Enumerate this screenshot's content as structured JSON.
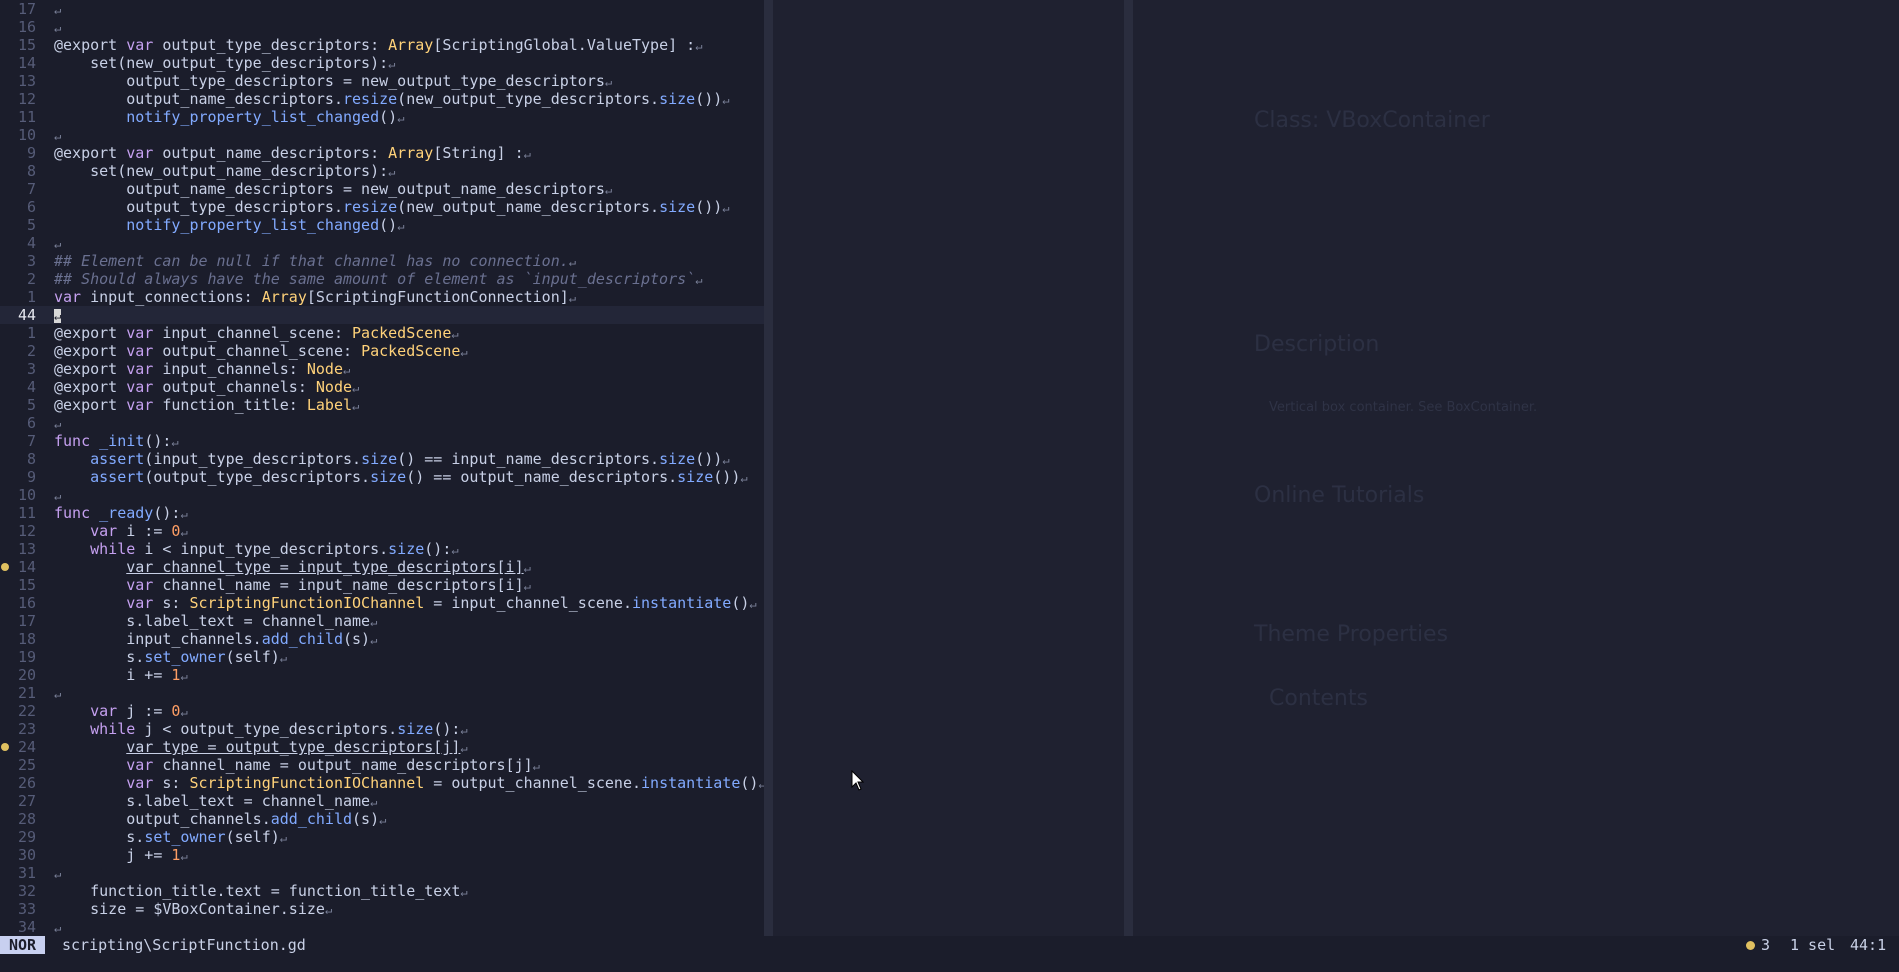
{
  "editor": {
    "current_line": "44",
    "lines": [
      {
        "n": "17",
        "tokens": []
      },
      {
        "n": "16",
        "tokens": []
      },
      {
        "n": "15",
        "tokens": [
          [
            "dec",
            "@export "
          ],
          [
            "kw",
            "var "
          ],
          [
            "plain",
            "output_type_descriptors: "
          ],
          [
            "type",
            "Array"
          ],
          [
            "plain",
            "[ScriptingGlobal.ValueType] :"
          ]
        ]
      },
      {
        "n": "14",
        "tokens": [
          [
            "plain",
            "    set(new_output_type_descriptors):"
          ]
        ]
      },
      {
        "n": "13",
        "tokens": [
          [
            "plain",
            "        output_type_descriptors = new_output_type_descriptors"
          ]
        ]
      },
      {
        "n": "12",
        "tokens": [
          [
            "plain",
            "        output_name_descriptors."
          ],
          [
            "fn",
            "resize"
          ],
          [
            "plain",
            "(new_output_type_descriptors."
          ],
          [
            "fn",
            "size"
          ],
          [
            "plain",
            "())"
          ]
        ]
      },
      {
        "n": "11",
        "tokens": [
          [
            "plain",
            "        "
          ],
          [
            "fn",
            "notify_property_list_changed"
          ],
          [
            "plain",
            "()"
          ]
        ]
      },
      {
        "n": "10",
        "tokens": []
      },
      {
        "n": "9",
        "tokens": [
          [
            "dec",
            "@export "
          ],
          [
            "kw",
            "var "
          ],
          [
            "plain",
            "output_name_descriptors: "
          ],
          [
            "type",
            "Array"
          ],
          [
            "plain",
            "[String] :"
          ]
        ]
      },
      {
        "n": "8",
        "tokens": [
          [
            "plain",
            "    set(new_output_name_descriptors):"
          ]
        ]
      },
      {
        "n": "7",
        "tokens": [
          [
            "plain",
            "        output_name_descriptors = new_output_name_descriptors"
          ]
        ]
      },
      {
        "n": "6",
        "tokens": [
          [
            "plain",
            "        output_type_descriptors."
          ],
          [
            "fn",
            "resize"
          ],
          [
            "plain",
            "(new_output_name_descriptors."
          ],
          [
            "fn",
            "size"
          ],
          [
            "plain",
            "())"
          ]
        ]
      },
      {
        "n": "5",
        "tokens": [
          [
            "plain",
            "        "
          ],
          [
            "fn",
            "notify_property_list_changed"
          ],
          [
            "plain",
            "()"
          ]
        ]
      },
      {
        "n": "4",
        "tokens": []
      },
      {
        "n": "3",
        "tokens": [
          [
            "cmt",
            "## Element can be null if that channel has no connection."
          ]
        ]
      },
      {
        "n": "2",
        "tokens": [
          [
            "cmt",
            "## Should always have the same amount of element as `input_descriptors`"
          ]
        ]
      },
      {
        "n": "1",
        "tokens": [
          [
            "kw",
            "var "
          ],
          [
            "plain",
            "input_connections: "
          ],
          [
            "type",
            "Array"
          ],
          [
            "plain",
            "[ScriptingFunctionConnection]"
          ]
        ]
      },
      {
        "n": "44",
        "current": true,
        "tokens": []
      },
      {
        "n": "1",
        "tokens": [
          [
            "dec",
            "@export "
          ],
          [
            "kw",
            "var "
          ],
          [
            "plain",
            "input_channel_scene: "
          ],
          [
            "type",
            "PackedScene"
          ]
        ]
      },
      {
        "n": "2",
        "tokens": [
          [
            "dec",
            "@export "
          ],
          [
            "kw",
            "var "
          ],
          [
            "plain",
            "output_channel_scene: "
          ],
          [
            "type",
            "PackedScene"
          ]
        ]
      },
      {
        "n": "3",
        "tokens": [
          [
            "dec",
            "@export "
          ],
          [
            "kw",
            "var "
          ],
          [
            "plain",
            "input_channels: "
          ],
          [
            "type",
            "Node"
          ]
        ]
      },
      {
        "n": "4",
        "tokens": [
          [
            "dec",
            "@export "
          ],
          [
            "kw",
            "var "
          ],
          [
            "plain",
            "output_channels: "
          ],
          [
            "type",
            "Node"
          ]
        ]
      },
      {
        "n": "5",
        "tokens": [
          [
            "dec",
            "@export "
          ],
          [
            "kw",
            "var "
          ],
          [
            "plain",
            "function_title: "
          ],
          [
            "type",
            "Label"
          ]
        ]
      },
      {
        "n": "6",
        "tokens": []
      },
      {
        "n": "7",
        "tokens": [
          [
            "kw",
            "func "
          ],
          [
            "fn",
            "_init"
          ],
          [
            "plain",
            "():"
          ]
        ]
      },
      {
        "n": "8",
        "tokens": [
          [
            "plain",
            "    "
          ],
          [
            "fn",
            "assert"
          ],
          [
            "plain",
            "(input_type_descriptors."
          ],
          [
            "fn",
            "size"
          ],
          [
            "plain",
            "() == input_name_descriptors."
          ],
          [
            "fn",
            "size"
          ],
          [
            "plain",
            "())"
          ]
        ]
      },
      {
        "n": "9",
        "tokens": [
          [
            "plain",
            "    "
          ],
          [
            "fn",
            "assert"
          ],
          [
            "plain",
            "(output_type_descriptors."
          ],
          [
            "fn",
            "size"
          ],
          [
            "plain",
            "() == output_name_descriptors."
          ],
          [
            "fn",
            "size"
          ],
          [
            "plain",
            "())"
          ]
        ]
      },
      {
        "n": "10",
        "tokens": []
      },
      {
        "n": "11",
        "tokens": [
          [
            "kw",
            "func "
          ],
          [
            "fn",
            "_ready"
          ],
          [
            "plain",
            "():"
          ]
        ]
      },
      {
        "n": "12",
        "tokens": [
          [
            "plain",
            "    "
          ],
          [
            "kw",
            "var "
          ],
          [
            "plain",
            "i := "
          ],
          [
            "num",
            "0"
          ]
        ]
      },
      {
        "n": "13",
        "tokens": [
          [
            "plain",
            "    "
          ],
          [
            "kw",
            "while "
          ],
          [
            "plain",
            "i < input_type_descriptors."
          ],
          [
            "fn",
            "size"
          ],
          [
            "plain",
            "():"
          ]
        ]
      },
      {
        "n": "14",
        "mark": true,
        "tokens": [
          [
            "plain",
            "        "
          ],
          [
            "ul",
            "var channel_type = input_type_descriptors[i]"
          ]
        ]
      },
      {
        "n": "15",
        "tokens": [
          [
            "plain",
            "        "
          ],
          [
            "kw",
            "var "
          ],
          [
            "plain",
            "channel_name = input_name_descriptors[i]"
          ]
        ]
      },
      {
        "n": "16",
        "tokens": [
          [
            "plain",
            "        "
          ],
          [
            "kw",
            "var "
          ],
          [
            "plain",
            "s: "
          ],
          [
            "type",
            "ScriptingFunctionIOChannel"
          ],
          [
            "plain",
            " = input_channel_scene."
          ],
          [
            "fn",
            "instantiate"
          ],
          [
            "plain",
            "()"
          ]
        ]
      },
      {
        "n": "17",
        "tokens": [
          [
            "plain",
            "        s.label_text = channel_name"
          ]
        ]
      },
      {
        "n": "18",
        "tokens": [
          [
            "plain",
            "        input_channels."
          ],
          [
            "fn",
            "add_child"
          ],
          [
            "plain",
            "(s)"
          ]
        ]
      },
      {
        "n": "19",
        "tokens": [
          [
            "plain",
            "        s."
          ],
          [
            "fn",
            "set_owner"
          ],
          [
            "plain",
            "(self)"
          ]
        ]
      },
      {
        "n": "20",
        "tokens": [
          [
            "plain",
            "        i += "
          ],
          [
            "num",
            "1"
          ]
        ]
      },
      {
        "n": "21",
        "tokens": []
      },
      {
        "n": "22",
        "tokens": [
          [
            "plain",
            "    "
          ],
          [
            "kw",
            "var "
          ],
          [
            "plain",
            "j := "
          ],
          [
            "num",
            "0"
          ]
        ]
      },
      {
        "n": "23",
        "tokens": [
          [
            "plain",
            "    "
          ],
          [
            "kw",
            "while "
          ],
          [
            "plain",
            "j < output_type_descriptors."
          ],
          [
            "fn",
            "size"
          ],
          [
            "plain",
            "():"
          ]
        ]
      },
      {
        "n": "24",
        "mark": true,
        "tokens": [
          [
            "plain",
            "        "
          ],
          [
            "ul",
            "var type = output_type_descriptors[j]"
          ]
        ]
      },
      {
        "n": "25",
        "tokens": [
          [
            "plain",
            "        "
          ],
          [
            "kw",
            "var "
          ],
          [
            "plain",
            "channel_name = output_name_descriptors[j]"
          ]
        ]
      },
      {
        "n": "26",
        "tokens": [
          [
            "plain",
            "        "
          ],
          [
            "kw",
            "var "
          ],
          [
            "plain",
            "s: "
          ],
          [
            "type",
            "ScriptingFunctionIOChannel"
          ],
          [
            "plain",
            " = output_channel_scene."
          ],
          [
            "fn",
            "instantiate"
          ],
          [
            "plain",
            "()"
          ]
        ]
      },
      {
        "n": "27",
        "tokens": [
          [
            "plain",
            "        s.label_text = channel_name"
          ]
        ]
      },
      {
        "n": "28",
        "tokens": [
          [
            "plain",
            "        output_channels."
          ],
          [
            "fn",
            "add_child"
          ],
          [
            "plain",
            "(s)"
          ]
        ]
      },
      {
        "n": "29",
        "tokens": [
          [
            "plain",
            "        s."
          ],
          [
            "fn",
            "set_owner"
          ],
          [
            "plain",
            "(self)"
          ]
        ]
      },
      {
        "n": "30",
        "tokens": [
          [
            "plain",
            "        j += "
          ],
          [
            "num",
            "1"
          ]
        ]
      },
      {
        "n": "31",
        "tokens": []
      },
      {
        "n": "32",
        "tokens": [
          [
            "plain",
            "    function_title.text = function_title_text"
          ]
        ]
      },
      {
        "n": "33",
        "tokens": [
          [
            "plain",
            "    size = $VBoxContainer.size"
          ]
        ]
      },
      {
        "n": "34",
        "tokens": []
      }
    ]
  },
  "background_app": {
    "class_title": "Class: VBoxContainer",
    "description_heading": "Description",
    "description_text": "Vertical box container. See BoxContainer.",
    "tutorials_heading": "Online Tutorials",
    "theme_heading": "Theme Properties",
    "contents_heading": "Contents"
  },
  "statusbar": {
    "mode": "NOR",
    "file": "scripting\\ScriptFunction.gd",
    "diagnostics": "3",
    "selection": "1 sel",
    "position": "44:1"
  },
  "colors": {
    "background": "#1b1d2b",
    "keyword": "#c5a0f0",
    "function": "#82aaff",
    "type": "#ffd27a",
    "number": "#ff9e64",
    "comment": "#6a7090",
    "warning_dot": "#e0c060"
  }
}
